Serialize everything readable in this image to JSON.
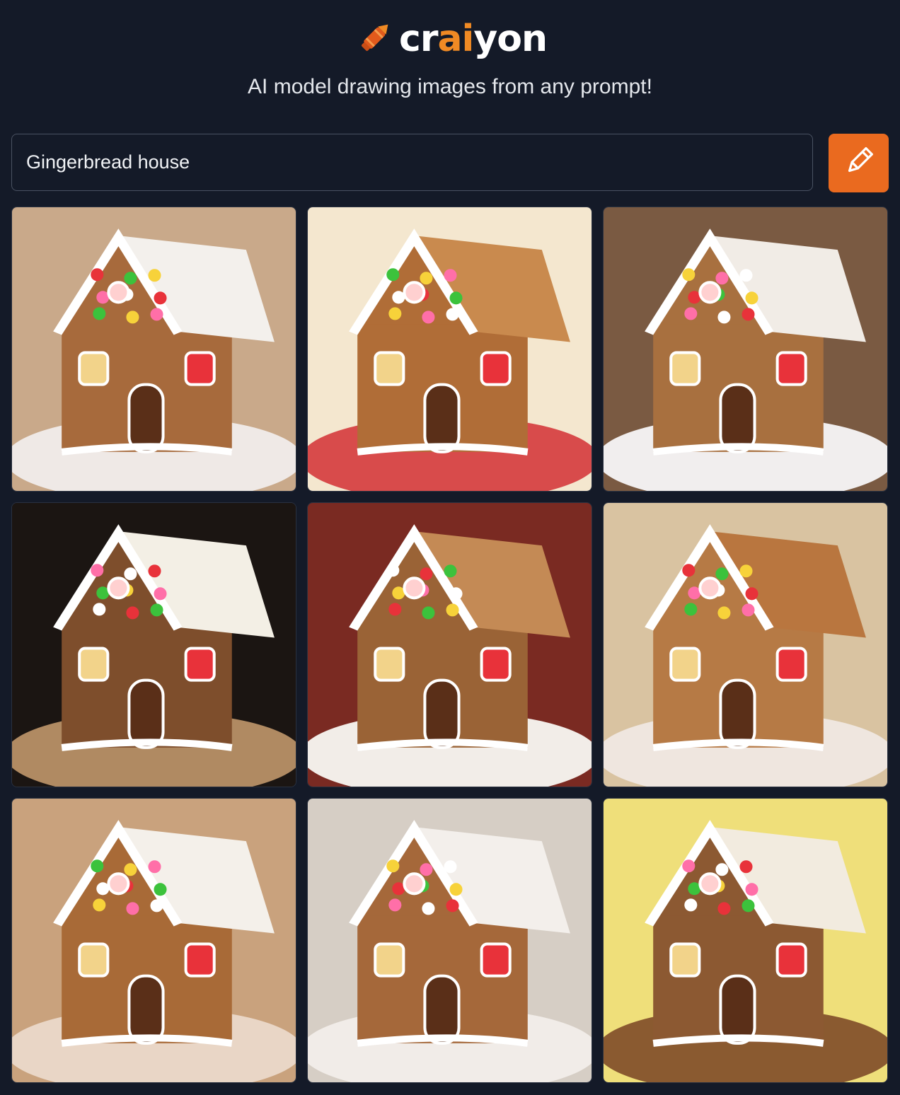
{
  "brand": {
    "name_prefix": "cr",
    "name_ai": "ai",
    "name_suffix": "yon",
    "accent": "#f08a24",
    "icon": "crayon-icon"
  },
  "tagline": "AI model drawing images from any prompt!",
  "prompt": {
    "value": "Gingerbread house"
  },
  "draw_button": {
    "icon": "pencil-icon",
    "color": "#ea6a1f"
  },
  "results": [
    {
      "subject": "gingerbread-house",
      "bg": "#c9a98a",
      "roof": "#f3f0ec",
      "wall": "#a76a3c",
      "base": "#efe9e6"
    },
    {
      "subject": "gingerbread-house",
      "bg": "#f4e7cf",
      "roof": "#c98a4e",
      "wall": "#b06d37",
      "base": "#d84b4b"
    },
    {
      "subject": "gingerbread-house",
      "bg": "#7a5a42",
      "roof": "#f1ece6",
      "wall": "#a8703f",
      "base": "#f1eeee"
    },
    {
      "subject": "gingerbread-house",
      "bg": "#1b1512",
      "roof": "#f3efe5",
      "wall": "#7e4e2c",
      "base": "#b08a62"
    },
    {
      "subject": "gingerbread-house",
      "bg": "#7a2a22",
      "roof": "#c48a55",
      "wall": "#9a6336",
      "base": "#f2ede8"
    },
    {
      "subject": "gingerbread-house",
      "bg": "#d9c3a1",
      "roof": "#b9763f",
      "wall": "#b67a45",
      "base": "#efe6df"
    },
    {
      "subject": "gingerbread-house",
      "bg": "#c9a27d",
      "roof": "#f4f0ea",
      "wall": "#a86a37",
      "base": "#e9d6c6"
    },
    {
      "subject": "gingerbread-house",
      "bg": "#d6cec5",
      "roof": "#f3efeb",
      "wall": "#a5683a",
      "base": "#f1ece8"
    },
    {
      "subject": "gingerbread-house",
      "bg": "#efdf7a",
      "roof": "#f2ebdf",
      "wall": "#8c5932",
      "base": "#8a5a30"
    }
  ]
}
